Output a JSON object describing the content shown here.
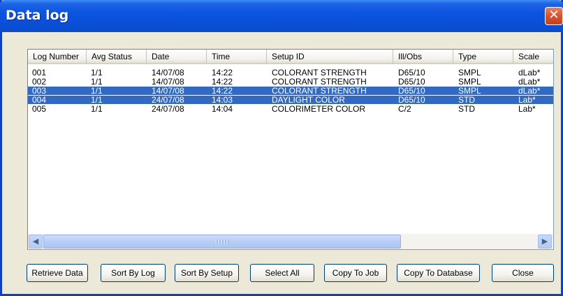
{
  "window": {
    "title": "Data log",
    "close_glyph": "✕"
  },
  "list": {
    "columns": [
      "Log Number",
      "Avg Status",
      "Date",
      "Time",
      "Setup ID",
      "Ill/Obs",
      "Type",
      "Scale"
    ],
    "rows": [
      {
        "log": "001",
        "avg": "1/1",
        "date": "14/07/08",
        "time": "14:22",
        "setup": "COLORANT STRENGTH",
        "ill": "D65/10",
        "type": "SMPL",
        "scale": "dLab*",
        "selected": false
      },
      {
        "log": "002",
        "avg": "1/1",
        "date": "14/07/08",
        "time": "14:22",
        "setup": "COLORANT STRENGTH",
        "ill": "D65/10",
        "type": "SMPL",
        "scale": "dLab*",
        "selected": false
      },
      {
        "log": "003",
        "avg": "1/1",
        "date": "14/07/08",
        "time": "14:22",
        "setup": "COLORANT STRENGTH",
        "ill": "D65/10",
        "type": "SMPL",
        "scale": "dLab*",
        "selected": true
      },
      {
        "log": "004",
        "avg": "1/1",
        "date": "24/07/08",
        "time": "14:03",
        "setup": "DAYLIGHT COLOR",
        "ill": "D65/10",
        "type": "STD",
        "scale": "Lab*",
        "selected": true
      },
      {
        "log": "005",
        "avg": "1/1",
        "date": "24/07/08",
        "time": "14:04",
        "setup": "COLORIMETER COLOR",
        "ill": "C/2",
        "type": "STD",
        "scale": "Lab*",
        "selected": false
      }
    ]
  },
  "scrollbar": {
    "left_arrow": "◀",
    "right_arrow": "▶"
  },
  "buttons": {
    "retrieve": "Retrieve Data",
    "sort_log": "Sort By Log",
    "sort_setup": "Sort By Setup",
    "select_all": "Select All",
    "copy_job": "Copy To Job",
    "copy_db": "Copy To Database",
    "close": "Close"
  },
  "colors": {
    "titlebar": "#0a4fd8",
    "selection": "#316ac5",
    "dialog_bg": "#ece9d8",
    "close_button": "#d9522e"
  }
}
